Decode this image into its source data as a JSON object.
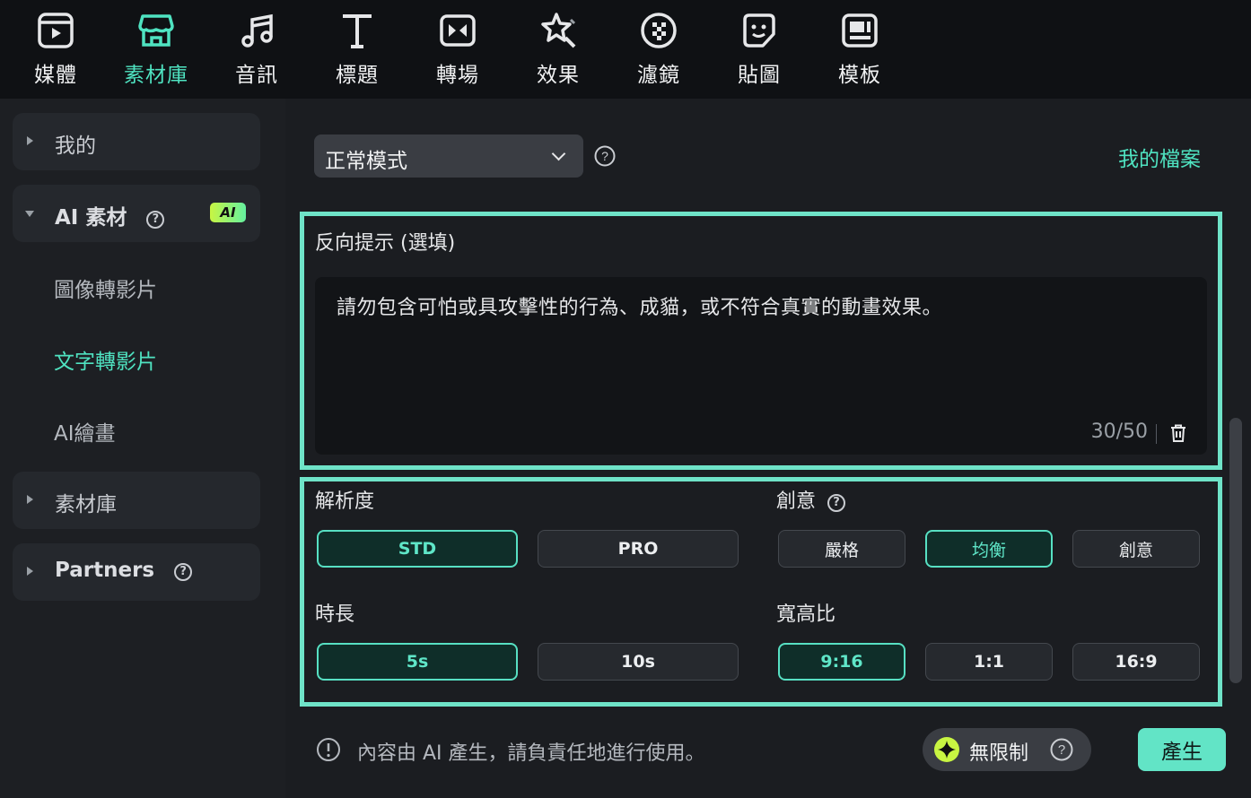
{
  "toolbar": {
    "items": [
      {
        "label": "媒體",
        "icon": "media-icon"
      },
      {
        "label": "素材庫",
        "icon": "store-icon"
      },
      {
        "label": "音訊",
        "icon": "music-note-icon"
      },
      {
        "label": "標題",
        "icon": "title-t-icon"
      },
      {
        "label": "轉場",
        "icon": "transition-icon"
      },
      {
        "label": "效果",
        "icon": "effects-star-icon"
      },
      {
        "label": "濾鏡",
        "icon": "filter-icon"
      },
      {
        "label": "貼圖",
        "icon": "sticker-icon"
      },
      {
        "label": "模板",
        "icon": "template-icon"
      }
    ],
    "active_index": 1
  },
  "sidebar": {
    "mine": "我的",
    "ai_assets": "AI 素材",
    "ai_badge": "AI",
    "sub_items": [
      "圖像轉影片",
      "文字轉影片",
      "AI繪畫"
    ],
    "active_sub_index": 1,
    "library": "素材庫",
    "partners": "Partners"
  },
  "main": {
    "mode_select": {
      "value": "正常模式"
    },
    "my_files": "我的檔案",
    "negative_prompt": {
      "label": "反向提示 (選填)",
      "text": "請勿包含可怕或具攻擊性的行為、成貓，或不符合真實的動畫效果。",
      "counter": "30/50"
    },
    "resolution": {
      "label": "解析度",
      "options": [
        "STD",
        "PRO"
      ],
      "selected": "STD"
    },
    "creativity": {
      "label": "創意",
      "options": [
        "嚴格",
        "均衡",
        "創意"
      ],
      "selected": "均衡"
    },
    "duration": {
      "label": "時長",
      "options": [
        "5s",
        "10s"
      ],
      "selected": "5s"
    },
    "aspect_ratio": {
      "label": "寬高比",
      "options": [
        "9:16",
        "1:1",
        "16:9"
      ],
      "selected": "9:16"
    },
    "notice": "內容由 AI 產生，請負責任地進行使用。",
    "unlimited": "無限制",
    "generate": "產生"
  },
  "colors": {
    "accent": "#4fe3c1",
    "panel_border": "#6fe3c8",
    "generate_bg": "#62e4c6"
  }
}
